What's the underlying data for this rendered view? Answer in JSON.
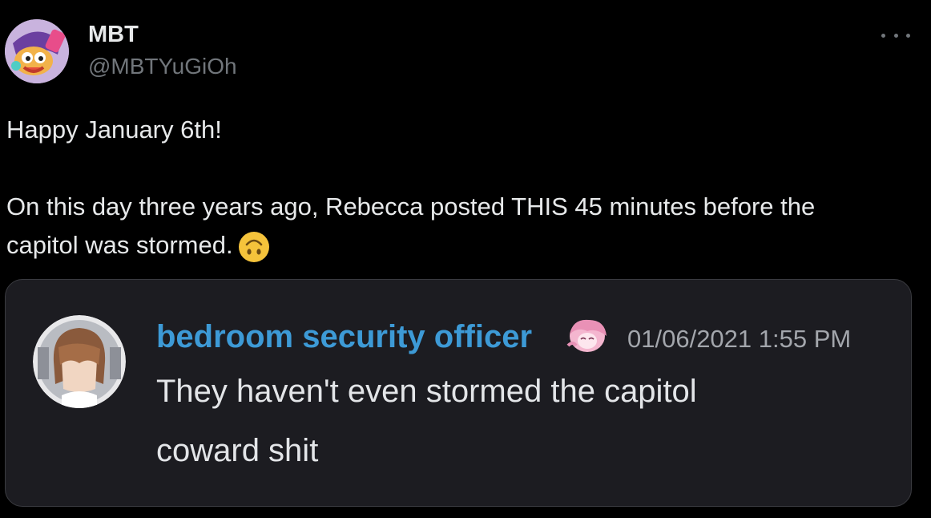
{
  "tweet": {
    "author": {
      "display_name": "MBT",
      "handle": "@MBTYuGiOh",
      "avatar_icon": "cartoon-character-avatar-icon"
    },
    "menu_icon": "more-options-icon",
    "text_lines": [
      "Happy January 6th!",
      "On this day three years ago, Rebecca posted THIS 45 minutes before the",
      "capitol was stormed."
    ],
    "emoji": "upside-down-face-emoji",
    "colors": {
      "background": "#000000",
      "text": "#e7e9ea",
      "secondary_text": "#71767b"
    }
  },
  "embedded_message": {
    "username": "bedroom security officer",
    "badge_icon": "pink-hair-character-icon",
    "timestamp": "01/06/2021 1:55 PM",
    "avatar_icon": "anime-character-avatar-icon",
    "lines": [
      "They haven't even stormed the capitol",
      "coward shit"
    ],
    "colors": {
      "card_background": "#1c1c21",
      "username": "#3d9ad6",
      "timestamp": "#a3a6ac",
      "message_text": "#e3e5e8"
    }
  }
}
